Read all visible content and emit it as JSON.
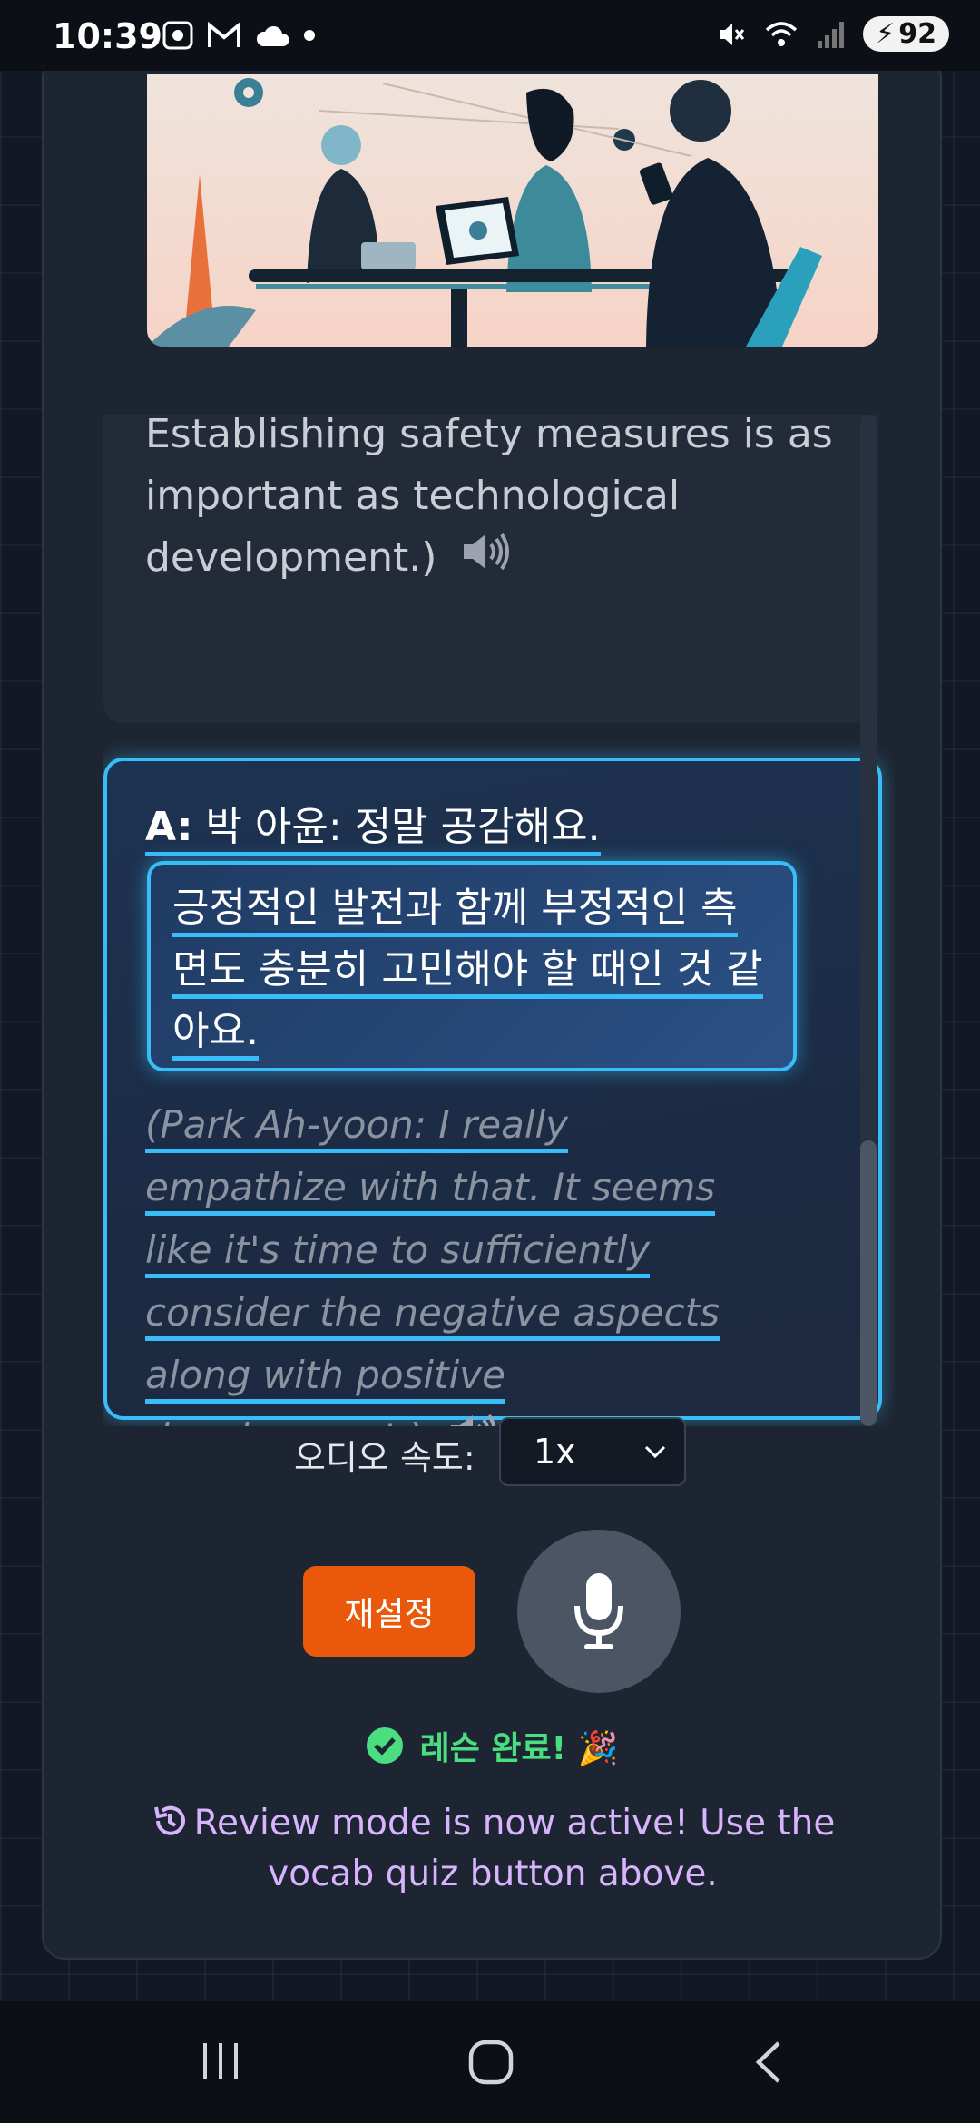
{
  "status_bar": {
    "time": "10:39",
    "battery": "92",
    "icons": [
      "screenshot-icon",
      "gmail-icon",
      "cloud-icon",
      "dot-icon",
      "mute-icon",
      "wifi-icon",
      "signal-icon",
      "battery-icon"
    ]
  },
  "illustration": {
    "description_icon": "people-at-table-illustration"
  },
  "previous_message": {
    "translation_tail": "minimize such risks seem urgent. Establishing safety measures is as important as technological development.)"
  },
  "active_message": {
    "speaker_prefix": "A:",
    "speaker_name": "박 아윤: 정말 공감해요.",
    "korean": "긍정적인 발전과 함께 부정적인 측면도 충분히 고민해야 할 때인 것 같아요.",
    "translation": "(Park Ah-yoon: I really empathize with that. It seems like it's time to sufficiently consider the negative aspects along with positive development.)"
  },
  "audio_speed": {
    "label": "오디오 속도:",
    "selected": "1x"
  },
  "controls": {
    "reset_label": "재설정",
    "mic_icon": "microphone-icon"
  },
  "status": {
    "lesson_complete": "레슨 완료! 🎉",
    "review_message": "Review mode is now active! Use the vocab quiz button above."
  },
  "colors": {
    "accent": "#38bdf8",
    "reset": "#ea580c",
    "success": "#4ade80",
    "review": "#d8b4fe"
  }
}
